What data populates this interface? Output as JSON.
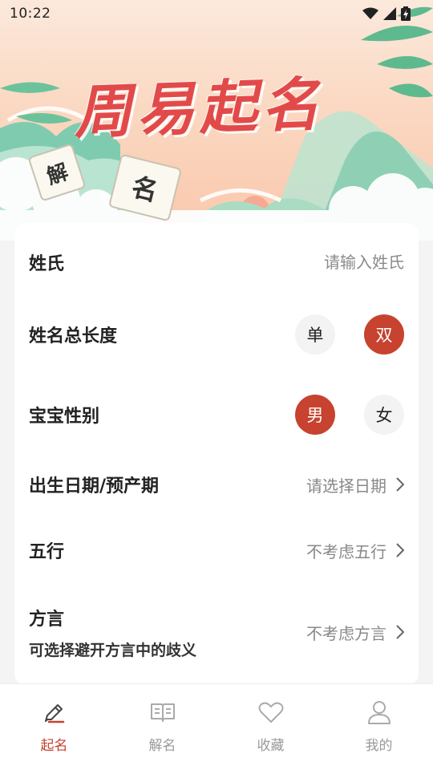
{
  "status_bar": {
    "time": "10:22"
  },
  "hero": {
    "title": "周易起名",
    "card_left": "解",
    "card_right": "名"
  },
  "form": {
    "surname": {
      "label": "姓氏",
      "placeholder": "请输入姓氏"
    },
    "name_length": {
      "label": "姓名总长度",
      "options": [
        "单",
        "双"
      ],
      "selected": "双"
    },
    "gender": {
      "label": "宝宝性别",
      "options": [
        "男",
        "女"
      ],
      "selected": "男"
    },
    "birth_date": {
      "label": "出生日期/预产期",
      "value": "请选择日期"
    },
    "wuxing": {
      "label": "五行",
      "value": "不考虑五行"
    },
    "dialect": {
      "label": "方言",
      "sublabel": "可选择避开方言中的歧义",
      "value": "不考虑方言"
    }
  },
  "colors": {
    "accent": "#c7422f",
    "title_red": "#e24a4a",
    "inactive_gray": "#9a9a9a"
  },
  "bottom_nav": {
    "items": [
      {
        "label": "起名",
        "icon": "pencil-icon",
        "active": true
      },
      {
        "label": "解名",
        "icon": "book-icon",
        "active": false
      },
      {
        "label": "收藏",
        "icon": "heart-icon",
        "active": false
      },
      {
        "label": "我的",
        "icon": "user-icon",
        "active": false
      }
    ]
  }
}
